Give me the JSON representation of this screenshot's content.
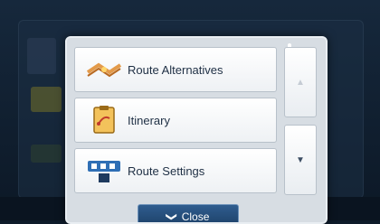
{
  "menu": {
    "items": [
      {
        "label": "Route Alternatives",
        "icon": "route-alternatives-icon"
      },
      {
        "label": "Itinerary",
        "icon": "itinerary-icon"
      },
      {
        "label": "Route Settings",
        "icon": "route-settings-icon"
      }
    ],
    "scroll_up_glyph": "▲",
    "scroll_down_glyph": "▼",
    "close_label": "Close",
    "close_glyph": "❯"
  },
  "colors": {
    "popup_bg": "#d7dde3",
    "button_blue": "#1b3d63",
    "text_dark": "#1e2f44"
  }
}
